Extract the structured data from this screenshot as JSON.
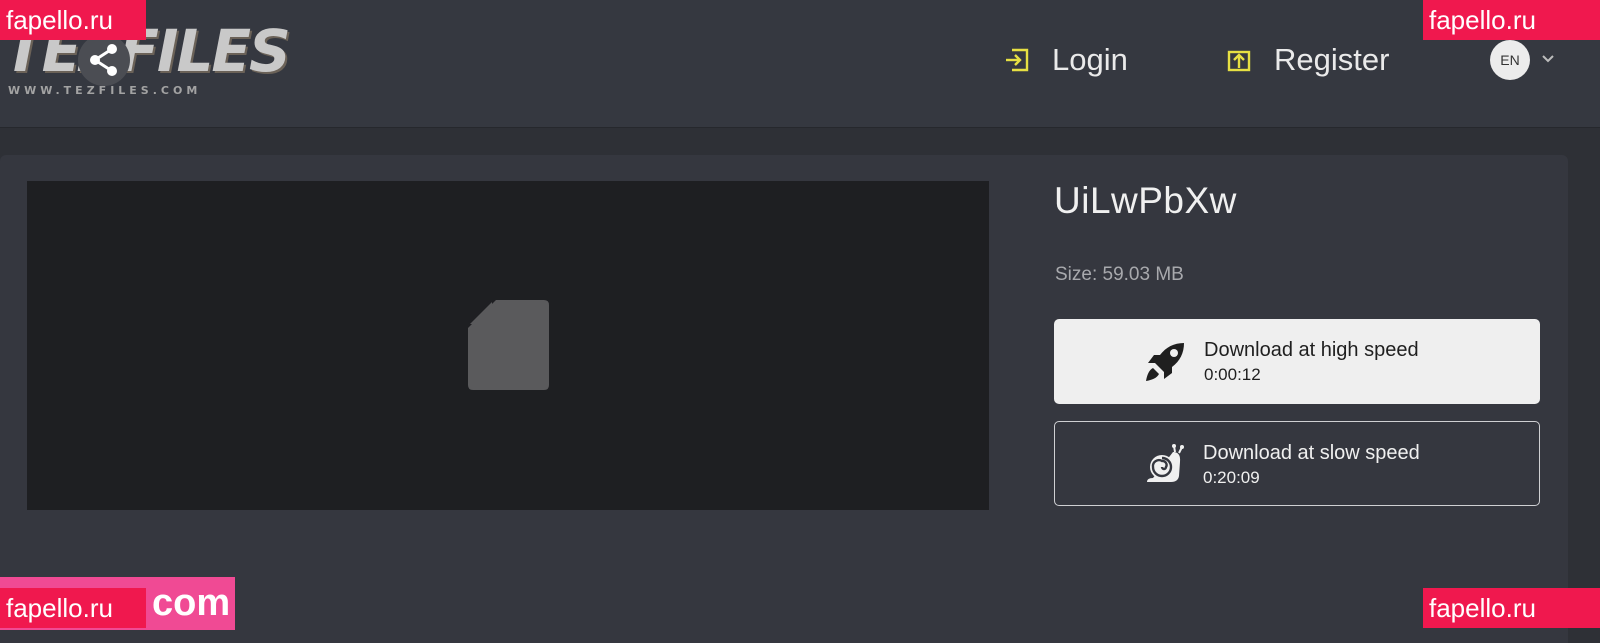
{
  "header": {
    "logo_text": "TEZFILES",
    "logo_url": "WWW.TEZFILES.COM",
    "nav": {
      "login_label": "Login",
      "register_label": "Register"
    },
    "language": "EN"
  },
  "file": {
    "title": "UiLwPbXw",
    "size": "Size: 59.03 MB"
  },
  "downloads": {
    "fast": {
      "label": "Download at high speed",
      "time": "0:00:12",
      "icon": "rocket-icon"
    },
    "slow": {
      "label": "Download at slow speed",
      "time": "0:20:09",
      "icon": "snail-icon"
    }
  },
  "watermarks": {
    "top_left": "fapello.ru",
    "top_right": "fapello.ru",
    "bottom_right": "fapello.ru",
    "bottom_left": "fapello.ru",
    "bottom_left_suffix": "com"
  },
  "colors": {
    "accent_icon": "#e7e043",
    "watermark_red": "#f0184e",
    "watermark_pink": "#f04a94"
  }
}
